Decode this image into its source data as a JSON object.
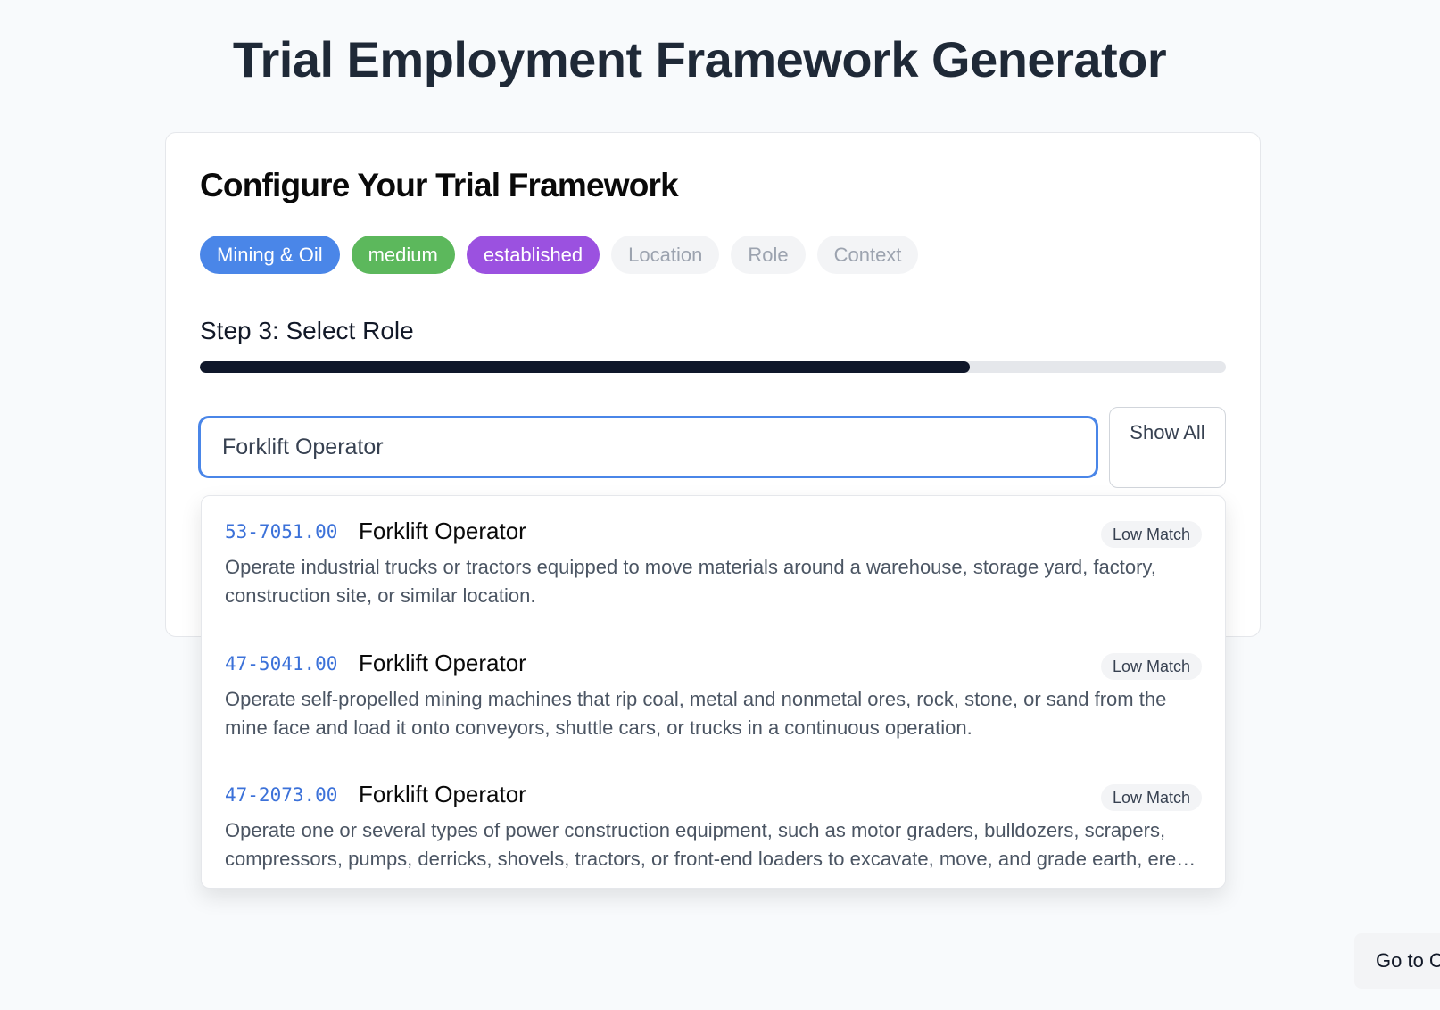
{
  "page_title": "Trial Employment Framework Generator",
  "card": {
    "title": "Configure Your Trial Framework",
    "chips": [
      {
        "label": "Mining & Oil",
        "state": "selected",
        "color": "#4a86e8"
      },
      {
        "label": "medium",
        "state": "selected",
        "color": "#5cb85c"
      },
      {
        "label": "established",
        "state": "selected",
        "color": "#9b51e0"
      },
      {
        "label": "Location",
        "state": "pending"
      },
      {
        "label": "Role",
        "state": "pending"
      },
      {
        "label": "Context",
        "state": "pending"
      }
    ],
    "step_label": "Step 3: Select Role",
    "progress_fraction": 0.75
  },
  "search": {
    "value": "Forklift Operator",
    "show_all_label": "Show All"
  },
  "results": [
    {
      "code": "53-7051.00",
      "title": "Forklift Operator",
      "badge": "Low Match",
      "description": "Operate industrial trucks or tractors equipped to move materials around a warehouse, storage yard, factory, construction site, or similar location."
    },
    {
      "code": "47-5041.00",
      "title": "Forklift Operator",
      "badge": "Low Match",
      "description": "Operate self-propelled mining machines that rip coal, metal and nonmetal ores, rock, stone, or sand from the mine face and load it onto conveyors, shuttle cars, or trucks in a continuous operation."
    },
    {
      "code": "47-2073.00",
      "title": "Forklift Operator",
      "badge": "Low Match",
      "description": "Operate one or several types of power construction equipment, such as motor graders, bulldozers, scrapers, compressors, pumps, derricks, shovels, tractors, or front-end loaders to excavate, move, and grade earth, erect structures, or pour concrete or other hard surface pavement."
    }
  ],
  "footer": {
    "goto_label": "Go to C"
  },
  "colors": {
    "accent": "#4a86e8",
    "code_link": "#3b71d9",
    "progress": "#0f172a"
  }
}
